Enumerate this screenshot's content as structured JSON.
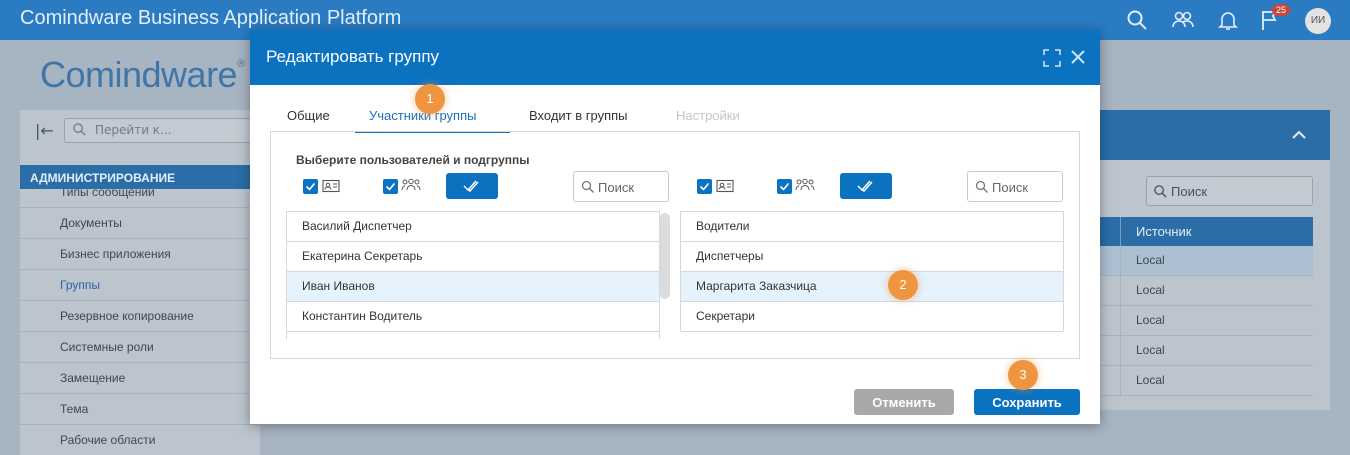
{
  "topbar": {
    "title": "Comindware Business Application Platform",
    "icons": [
      "search-icon",
      "users-icon",
      "bell-icon",
      "flag-icon"
    ],
    "notification_count": "25",
    "avatar_initials": "ИИ"
  },
  "background": {
    "logo": "Comindware",
    "logo_mark": "®",
    "sidebar": {
      "search_placeholder": "Перейти к...",
      "section_title": "АДМИНИСТРИРОВАНИЕ",
      "items": [
        {
          "label": "Типы сообщений"
        },
        {
          "label": "Документы"
        },
        {
          "label": "Бизнес приложения"
        },
        {
          "label": "Группы"
        },
        {
          "label": "Резервное копирование"
        },
        {
          "label": "Системные роли"
        },
        {
          "label": "Замещение"
        },
        {
          "label": "Тема"
        },
        {
          "label": "Рабочие области"
        }
      ]
    },
    "right_panel": {
      "search_placeholder": "Поиск",
      "column_header": "Источник",
      "rows": [
        "Local",
        "Local",
        "Local",
        "Local",
        "Local"
      ]
    }
  },
  "modal": {
    "title": "Редактировать группу",
    "tabs": [
      {
        "label": "Общие"
      },
      {
        "label": "Участники группы"
      },
      {
        "label": "Входит в группы"
      },
      {
        "label": "Настройки"
      }
    ],
    "select_label": "Выберите пользователей и подгруппы",
    "left": {
      "search_placeholder": "Поиск",
      "items": [
        "Василий Диспетчер",
        "Екатерина Секретарь",
        "Иван Иванов",
        "Константин Водитель"
      ]
    },
    "right": {
      "search_placeholder": "Поиск",
      "items": [
        "Водители",
        "Диспетчеры",
        "Маргарита Заказчица",
        "Секретари"
      ]
    },
    "cancel_label": "Отменить",
    "save_label": "Сохранить"
  },
  "markers": [
    "1",
    "2",
    "3"
  ],
  "colors": {
    "brand": "#0b72c0",
    "marker": "#f0953f",
    "selected_row": "#e6f3fc"
  }
}
